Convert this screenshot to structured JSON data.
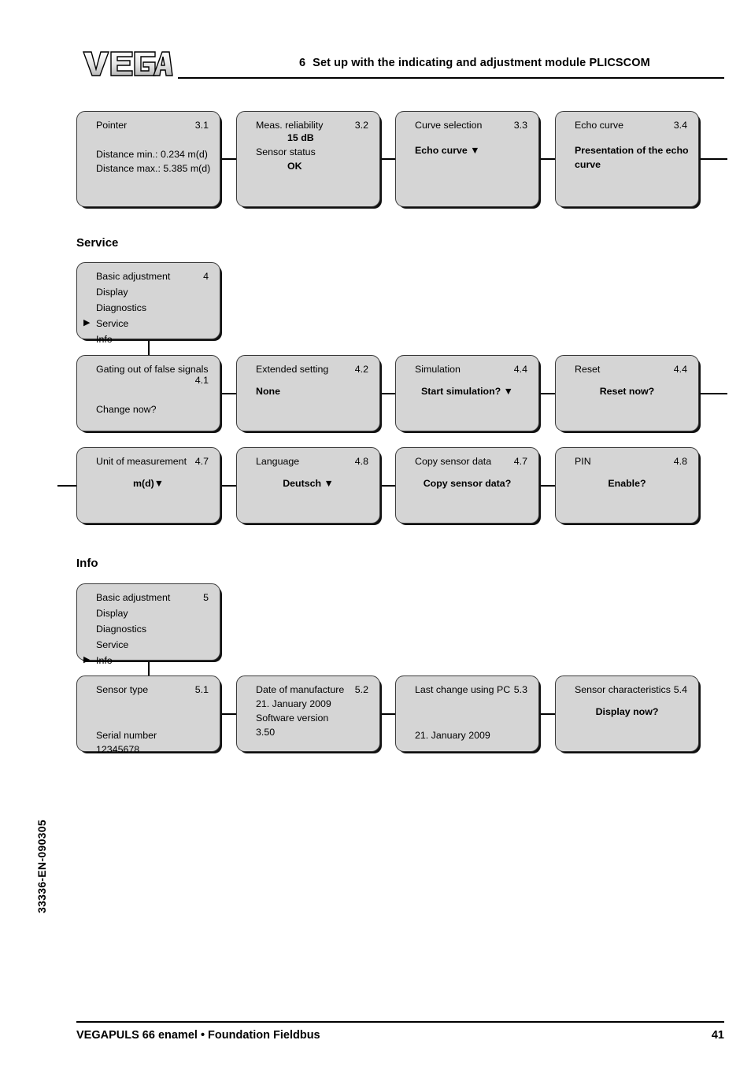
{
  "header": {
    "logo_alt": "VEGA",
    "section_number": "6",
    "title": "Set up with the indicating and adjustment module PLICSCOM"
  },
  "footer": {
    "product": "VEGAPULS 66 enamel • Foundation Fieldbus",
    "page_number": "41",
    "document_code": "33336-EN-090305"
  },
  "sections": [
    {
      "heading": "",
      "boxes": [
        {
          "title": "Pointer",
          "number": "3.1",
          "lines": [
            {
              "text": "Distance min.: 0.234 m(d)",
              "style": "plain"
            },
            {
              "text": "Distance max.: 5.385 m(d)",
              "style": "plain"
            }
          ]
        },
        {
          "title": "Meas. reliability",
          "number": "3.2",
          "lines": [
            {
              "text": "15 dB",
              "style": "indent-bold"
            },
            {
              "text": "Sensor status",
              "style": "plain"
            },
            {
              "text": "OK",
              "style": "indent-bold"
            }
          ]
        },
        {
          "title": "Curve selection",
          "number": "3.3",
          "lines": [
            {
              "text": "Echo curve ▼",
              "style": "bold"
            }
          ]
        },
        {
          "title": "Echo curve",
          "number": "3.4",
          "lines": [
            {
              "text": "Presentation of the echo",
              "style": "bold"
            },
            {
              "text": "curve",
              "style": "bold"
            }
          ]
        }
      ]
    }
  ],
  "service": {
    "heading": "Service",
    "menu": {
      "number": "4",
      "items": [
        {
          "label": "Basic adjustment",
          "selected": false
        },
        {
          "label": "Display",
          "selected": false
        },
        {
          "label": "Diagnostics",
          "selected": false
        },
        {
          "label": "Service",
          "selected": true
        },
        {
          "label": "Info",
          "selected": false
        }
      ]
    },
    "row1": [
      {
        "title": "Gating out of false signals",
        "number": "4.1",
        "lines": [
          {
            "text": "Change now?",
            "style": "plain"
          }
        ]
      },
      {
        "title": "Extended setting",
        "number": "4.2",
        "lines": [
          {
            "text": "None",
            "style": "bold"
          }
        ]
      },
      {
        "title": "Simulation",
        "number": "4.4",
        "lines": [
          {
            "text": "Start simulation? ▼",
            "style": "center-bold"
          }
        ]
      },
      {
        "title": "Reset",
        "number": "4.4",
        "lines": [
          {
            "text": "Reset now?",
            "style": "center-bold"
          }
        ]
      }
    ],
    "row2": [
      {
        "title": "Unit of measurement",
        "number": "4.7",
        "lines": [
          {
            "text": "m(d)▼",
            "style": "center-bold"
          }
        ]
      },
      {
        "title": "Language",
        "number": "4.8",
        "lines": [
          {
            "text": "Deutsch ▼",
            "style": "center-bold"
          }
        ]
      },
      {
        "title": "Copy sensor data",
        "number": "4.7",
        "lines": [
          {
            "text": "Copy sensor data?",
            "style": "center-bold"
          }
        ]
      },
      {
        "title": "PIN",
        "number": "4.8",
        "lines": [
          {
            "text": "Enable?",
            "style": "center-bold"
          }
        ]
      }
    ]
  },
  "info": {
    "heading": "Info",
    "menu": {
      "number": "5",
      "items": [
        {
          "label": "Basic adjustment",
          "selected": false
        },
        {
          "label": "Display",
          "selected": false
        },
        {
          "label": "Diagnostics",
          "selected": false
        },
        {
          "label": "Service",
          "selected": false
        },
        {
          "label": "Info",
          "selected": true
        }
      ]
    },
    "row1": [
      {
        "title": "Sensor type",
        "number": "5.1",
        "lines": [
          {
            "text": "Serial number",
            "style": "plain"
          },
          {
            "text": "12345678",
            "style": "plain"
          }
        ]
      },
      {
        "title": "Date of manufacture",
        "number": "5.2",
        "lines": [
          {
            "text": "21. January 2009",
            "style": "plain"
          },
          {
            "text": "Software version",
            "style": "plain"
          },
          {
            "text": "3.50",
            "style": "plain"
          }
        ]
      },
      {
        "title": "Last change using PC",
        "number": "5.3",
        "lines": [
          {
            "text": "21. January 2009",
            "style": "plain"
          }
        ]
      },
      {
        "title": "Sensor characteristics",
        "number": "5.4",
        "lines": [
          {
            "text": "Display now?",
            "style": "center-bold"
          }
        ]
      }
    ]
  }
}
